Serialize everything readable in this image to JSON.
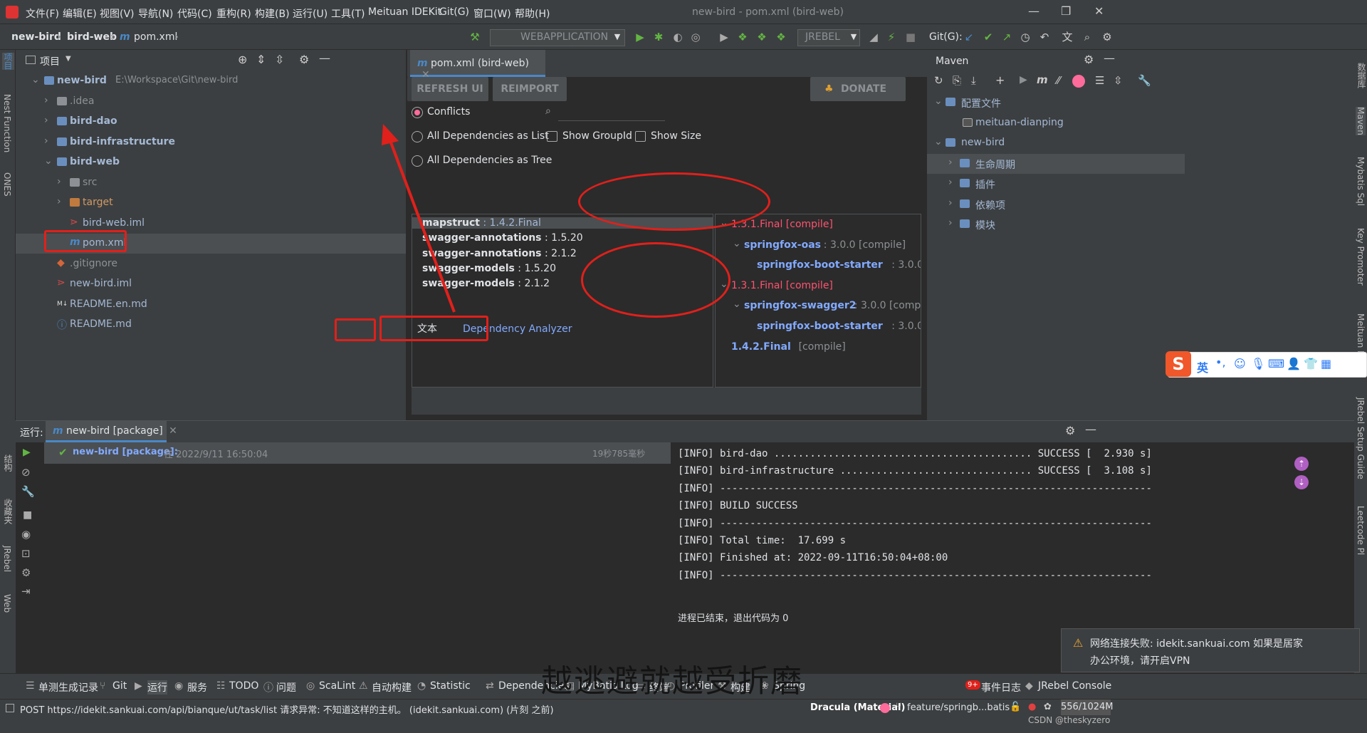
{
  "menubar": {
    "items": [
      "文件(F)",
      "编辑(E)",
      "视图(V)",
      "导航(N)",
      "代码(C)",
      "重构(R)",
      "构建(B)",
      "运行(U)",
      "工具(T)",
      "Meituan IDEKit",
      "Git(G)",
      "窗口(W)",
      "帮助(H)"
    ],
    "window_title": "new-bird - pom.xml (bird-web)"
  },
  "breadcrumb": {
    "items": [
      "new-bird",
      "bird-web",
      "pom.xml"
    ]
  },
  "toolbar": {
    "run_config": "WEBAPPLICATION",
    "jrebel": "JREBEL",
    "git_label": "Git(G):"
  },
  "left_strip": {
    "labels": [
      "项目",
      "Nest Function",
      "ONES"
    ]
  },
  "project": {
    "title": "项目",
    "tree": [
      {
        "name": "new-bird",
        "path": "E:\\Workspace\\Git\\new-bird",
        "level": 0,
        "expanded": true,
        "kind": "module"
      },
      {
        "name": ".idea",
        "level": 1,
        "expanded": false,
        "kind": "folder"
      },
      {
        "name": "bird-dao",
        "level": 1,
        "expanded": false,
        "kind": "module"
      },
      {
        "name": "bird-infrastructure",
        "level": 1,
        "expanded": false,
        "kind": "module"
      },
      {
        "name": "bird-web",
        "level": 1,
        "expanded": true,
        "kind": "module"
      },
      {
        "name": "src",
        "level": 2,
        "expanded": false,
        "kind": "folder"
      },
      {
        "name": "target",
        "level": 2,
        "expanded": false,
        "kind": "target"
      },
      {
        "name": "bird-web.iml",
        "level": 2,
        "kind": "iml"
      },
      {
        "name": "pom.xml",
        "level": 2,
        "kind": "maven",
        "selected": true
      },
      {
        "name": ".gitignore",
        "level": 1,
        "kind": "git"
      },
      {
        "name": "new-bird.iml",
        "level": 1,
        "kind": "iml"
      },
      {
        "name": "README.en.md",
        "level": 1,
        "kind": "md"
      },
      {
        "name": "README.md",
        "level": 1,
        "kind": "info"
      }
    ]
  },
  "editor": {
    "tab": "pom.xml (bird-web)",
    "buttons": {
      "refresh": "REFRESH UI",
      "reimport": "REIMPORT",
      "donate": "DONATE"
    },
    "options": {
      "conflicts": "Conflicts",
      "as_list": "All Dependencies as List",
      "as_tree": "All Dependencies as Tree",
      "show_groupid": "Show GroupId",
      "show_size": "Show Size"
    },
    "search_placeholder": "",
    "conflicts": [
      {
        "name": "mapstruct",
        "version": "1.4.2.Final"
      },
      {
        "name": "swagger-annotations",
        "version": "1.5.20"
      },
      {
        "name": "swagger-annotations",
        "version": "2.1.2"
      },
      {
        "name": "swagger-models",
        "version": "1.5.20"
      },
      {
        "name": "swagger-models",
        "version": "2.1.2"
      }
    ],
    "tree_nodes": [
      {
        "text": "1.3.1.Final [compile]",
        "style": "red",
        "indent": 0,
        "arrow": "v"
      },
      {
        "text": "springfox-oas",
        "ver": " : 3.0.0 [compile]",
        "style": "blue",
        "indent": 1,
        "arrow": "v"
      },
      {
        "text": "springfox-boot-starter",
        "ver": " : 3.0.0 [compile]",
        "style": "blue",
        "indent": 2,
        "arrow": ""
      },
      {
        "text": "1.3.1.Final [compile]",
        "style": "red",
        "indent": 0,
        "arrow": "v"
      },
      {
        "text": "springfox-swagger2",
        "ver": " : 3.0.0 [compile]",
        "style": "blue",
        "indent": 1,
        "arrow": "v"
      },
      {
        "text": "springfox-boot-starter",
        "ver": " : 3.0.0 [compile]",
        "style": "blue",
        "indent": 2,
        "arrow": ""
      },
      {
        "text": "1.4.2.Final",
        "ver": " [compile]",
        "style": "blue",
        "indent": 0,
        "arrow": ""
      }
    ],
    "bottom_tabs": {
      "text": "文本",
      "analyzer": "Dependency Analyzer"
    }
  },
  "maven": {
    "title": "Maven",
    "tree": [
      {
        "name": "配置文件",
        "level": 0,
        "expanded": true
      },
      {
        "name": "meituan-dianping",
        "level": 1,
        "checked": true
      },
      {
        "name": "new-bird",
        "level": 0,
        "expanded": true
      },
      {
        "name": "生命周期",
        "level": 1,
        "expanded": false,
        "selected": true
      },
      {
        "name": "插件",
        "level": 1,
        "expanded": false
      },
      {
        "name": "依赖项",
        "level": 1,
        "expanded": false
      },
      {
        "name": "模块",
        "level": 1,
        "expanded": false
      }
    ]
  },
  "right_strip": {
    "labels": [
      "数据库",
      "Maven",
      "Mybatis Sql",
      "Key Promoter",
      "Meituan IDEKit",
      "JRebel Setup Guide",
      "Leetcode Pl"
    ]
  },
  "run": {
    "label": "运行:",
    "tab": "new-bird [package]",
    "entry_name": "new-bird [package]:",
    "entry_time": "在 2022/9/11 16:50:04",
    "duration": "19秒785毫秒",
    "console": [
      "[INFO] bird-dao ........................................... SUCCESS [  2.930 s]",
      "[INFO] bird-infrastructure ................................ SUCCESS [  3.108 s]",
      "[INFO] ------------------------------------------------------------------------",
      "[INFO] BUILD SUCCESS",
      "[INFO] ------------------------------------------------------------------------",
      "[INFO] Total time:  17.699 s",
      "[INFO] Finished at: 2022-09-11T16:50:04+08:00",
      "[INFO] ------------------------------------------------------------------------",
      "",
      "进程已结束，退出代码为 0"
    ]
  },
  "left_strip_bottom": {
    "labels": [
      "结构",
      "收藏夹",
      "JRebel",
      "Web"
    ]
  },
  "notification": {
    "text1": "网络连接失败: idekit.sankuai.com 如果是居家",
    "text2": "办公环境，请开启VPN"
  },
  "watermark": "越逃避就越受折磨",
  "toolwindows": [
    "单测生成记录",
    "Git",
    "运行",
    "服务",
    "TODO",
    "问题",
    "ScaLint",
    "自动构建",
    "Statistic",
    "Dependencies",
    "MyBatis Log",
    "终端",
    "Profiler",
    "构建",
    "Spring",
    "事件日志",
    "JRebel Console"
  ],
  "event_badge": "9+",
  "status": {
    "message": "POST https://idekit.sankuai.com/api/bianque/ut/task/list 请求异常: 不知道这样的主机。 (idekit.sankuai.com) (片刻 之前)",
    "theme": "Dracula (Material)",
    "branch": "feature/springb...batis",
    "memory": "556/1024M",
    "credit": "CSDN @theskyzero"
  },
  "ime": {
    "lang": "英"
  },
  "colors": {
    "accent": "#4a88c7",
    "conflict_red": "#ff5370",
    "dep_blue": "#82aaff",
    "annotation": "#e0201b"
  }
}
